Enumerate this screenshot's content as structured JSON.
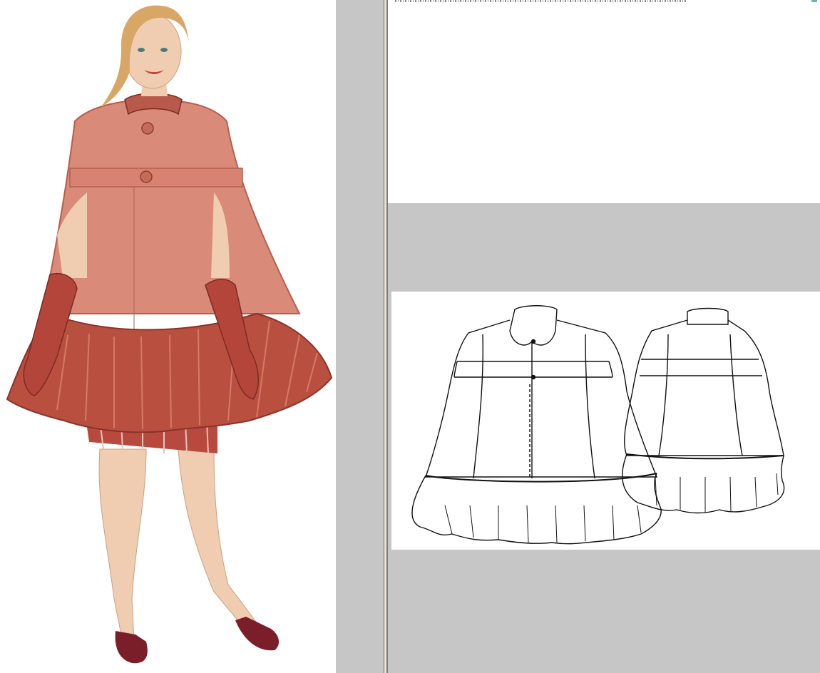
{
  "screen": {
    "left_panel": {
      "image": "fashion-illustration-model-in-cape-coat"
    },
    "right_panel": {
      "image": "technical-flat-sketch-front-and-back"
    }
  },
  "colors": {
    "gutter": "#c6c6c6",
    "cape": "#d98a78",
    "cape_shadow": "#b55f4e",
    "ruffle": "#b9503f",
    "skirt_plaid": "#b8493f",
    "skin": "#f0cdb0",
    "hair": "#d8a766",
    "shoes": "#7a1f2a",
    "accent_mark": "#5fb7c9"
  }
}
